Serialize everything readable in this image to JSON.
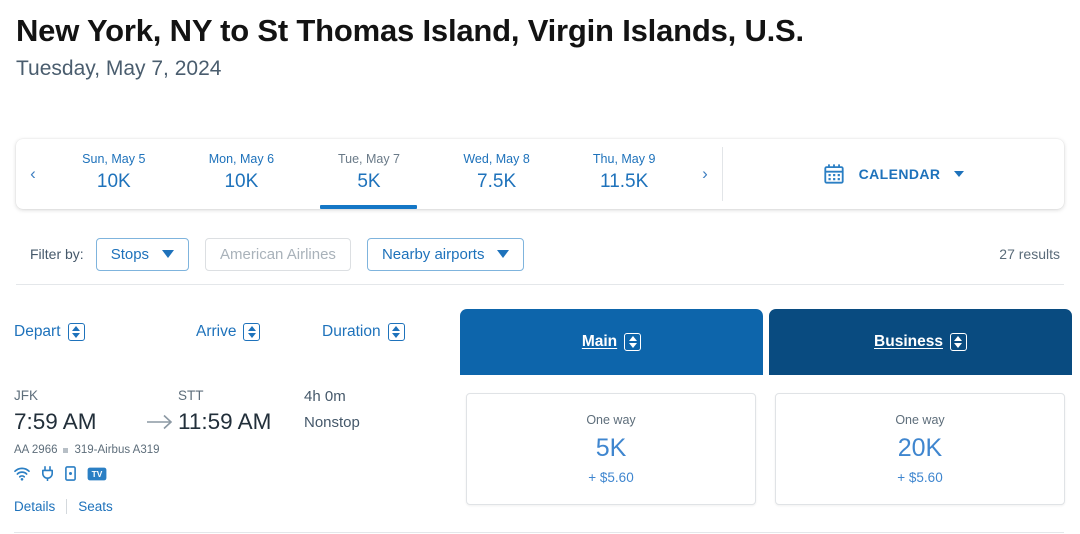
{
  "header": {
    "route_title": "New York, NY to St Thomas Island, Virgin Islands, U.S.",
    "date_subtitle": "Tuesday, May 7, 2024"
  },
  "date_bar": {
    "prev_arrow": "‹",
    "next_arrow": "›",
    "dates": [
      {
        "label": "Sun, May 5",
        "price": "10K",
        "selected": false
      },
      {
        "label": "Mon, May 6",
        "price": "10K",
        "selected": false
      },
      {
        "label": "Tue, May 7",
        "price": "5K",
        "selected": true
      },
      {
        "label": "Wed, May 8",
        "price": "7.5K",
        "selected": false
      },
      {
        "label": "Thu, May 9",
        "price": "11.5K",
        "selected": false
      }
    ],
    "calendar_label": "CALENDAR"
  },
  "filters": {
    "label": "Filter by:",
    "chips": [
      {
        "label": "Stops",
        "state": "active",
        "caret": true
      },
      {
        "label": "American Airlines",
        "state": "disabled",
        "caret": false
      },
      {
        "label": "Nearby airports",
        "state": "active",
        "caret": true
      }
    ],
    "results": "27 results"
  },
  "columns": {
    "depart": "Depart",
    "arrive": "Arrive",
    "duration": "Duration",
    "main": "Main",
    "business": "Business"
  },
  "flight": {
    "depart_code": "JFK",
    "depart_time": "7:59 AM",
    "arrive_code": "STT",
    "arrive_time": "11:59 AM",
    "duration": "4h 0m",
    "stops": "Nonstop",
    "flight_number": "AA 2966",
    "aircraft": "319-Airbus A319",
    "amenities": [
      "wifi-icon",
      "power-outlet-icon",
      "streaming-device-icon",
      "live-tv-icon"
    ],
    "details_link": "Details",
    "seats_link": "Seats",
    "fares": [
      {
        "cabin": "main",
        "trip_type": "One way",
        "points": "5K",
        "taxes": "+ $5.60"
      },
      {
        "cabin": "business",
        "trip_type": "One way",
        "points": "20K",
        "taxes": "+ $5.60"
      }
    ]
  },
  "colors": {
    "main_header": "#0d65ab",
    "business_header": "#094b80",
    "link_blue": "#1e72bb",
    "points_blue": "#3f86cf"
  }
}
